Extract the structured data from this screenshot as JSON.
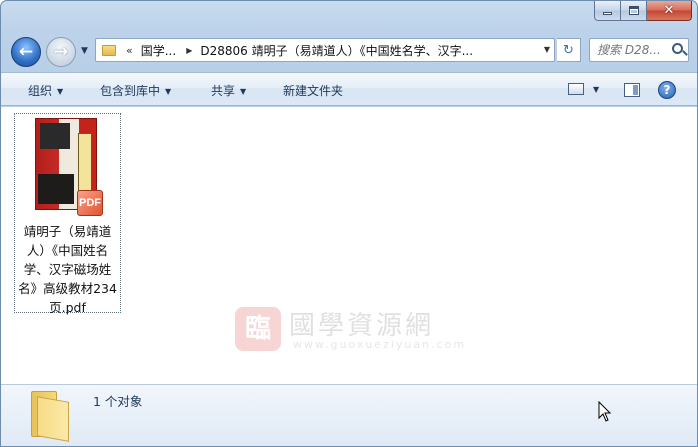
{
  "window": {
    "caption": {
      "minimize_icon": "minimize-icon",
      "maximize_icon": "maximize-icon",
      "close_icon": "close-icon"
    }
  },
  "nav": {
    "back_glyph": "←",
    "forward_glyph": "→",
    "history_glyph": "▼",
    "address": {
      "overflow_glyph": "«",
      "crumb_1": "国学...",
      "separator": "▶",
      "crumb_2": "D28806 靖明子（易靖道人）《中国姓名学、汉字...",
      "dropdown_glyph": "▼"
    },
    "refresh_glyph": "↻",
    "search": {
      "placeholder": "搜索 D28..."
    }
  },
  "commandbar": {
    "organize": "组织",
    "include_in_library": "包含到库中",
    "share": "共享",
    "new_folder": "新建文件夹",
    "dropdown_glyph": "▼",
    "help_glyph": "?"
  },
  "files": [
    {
      "name": "靖明子（易靖道人）《中国姓名学、汉字磁场姓名》高级教材234页.pdf",
      "badge": "PDF",
      "icon": "pdf-file-icon"
    }
  ],
  "watermark": {
    "seal": "臨",
    "title": "國學資源網",
    "url": "www.guoxueziyuan.com"
  },
  "details": {
    "count_text": "1 个对象",
    "icon": "folder-icon"
  },
  "colors": {
    "chrome": "#bcd2ea",
    "accent": "#2d6fc3",
    "close": "#c5452f",
    "pdf_badge": "#e2532f"
  }
}
